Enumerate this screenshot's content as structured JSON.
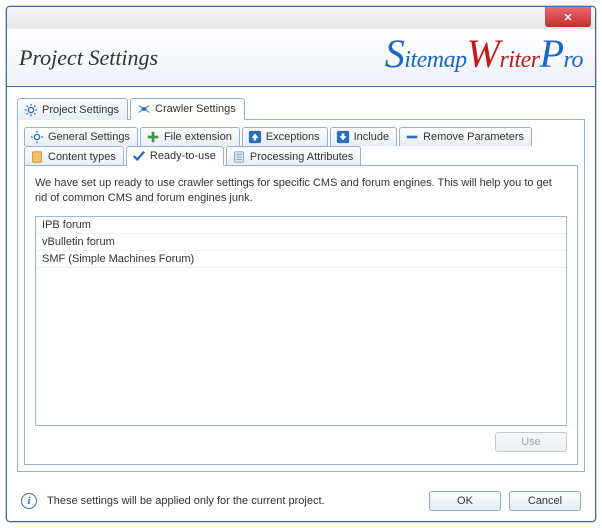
{
  "window": {
    "title": "Project Settings",
    "logo": {
      "s": "S",
      "itemap": "itemap",
      "w": "W",
      "riter": "riter",
      "p": "P",
      "ro": "ro"
    }
  },
  "outerTabs": [
    {
      "label": "Project Settings",
      "icon": "gear"
    },
    {
      "label": "Crawler Settings",
      "icon": "spider"
    }
  ],
  "innerTabsRow1": [
    {
      "label": "General Settings",
      "icon": "gear"
    },
    {
      "label": "File extension",
      "icon": "plus"
    },
    {
      "label": "Exceptions",
      "icon": "up"
    },
    {
      "label": "Include",
      "icon": "down"
    },
    {
      "label": "Remove Parameters",
      "icon": "minus"
    }
  ],
  "innerTabsRow2": [
    {
      "label": "Content types",
      "icon": "doc"
    },
    {
      "label": "Ready-to-use",
      "icon": "check"
    },
    {
      "label": "Processing Attributes",
      "icon": "page"
    }
  ],
  "readyToUse": {
    "description": "We have set up ready to use crawler settings for specific CMS and forum engines. This will help you to get rid of common CMS and forum engines junk.",
    "items": [
      "IPB forum",
      "vBulletin forum",
      "SMF (Simple Machines Forum)"
    ],
    "useLabel": "Use"
  },
  "footer": {
    "note": "These settings will be applied only for the current project.",
    "ok": "OK",
    "cancel": "Cancel"
  }
}
